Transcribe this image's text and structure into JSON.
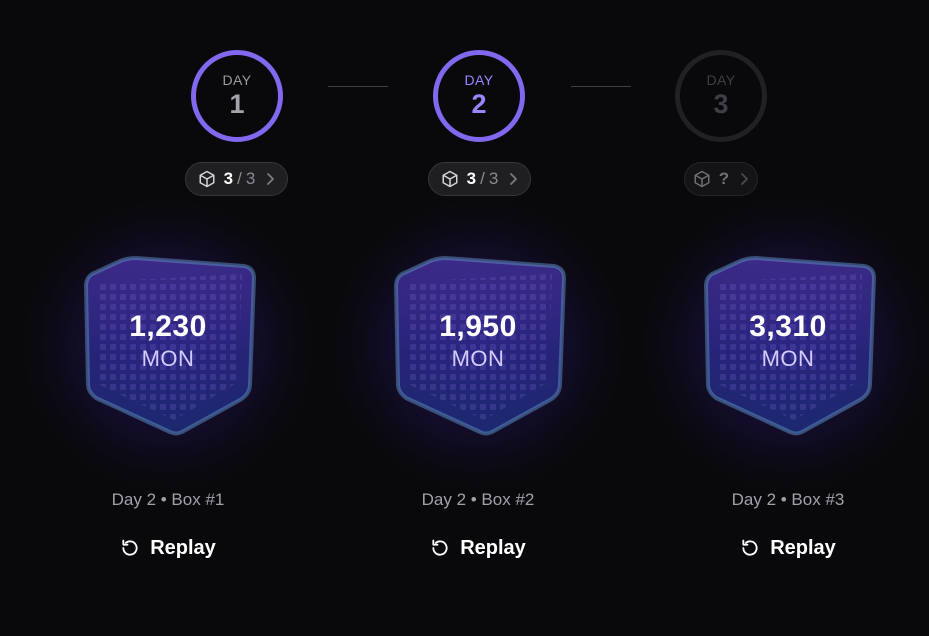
{
  "days": [
    {
      "label": "DAY",
      "number": "1",
      "state": "completed"
    },
    {
      "label": "DAY",
      "number": "2",
      "state": "current"
    },
    {
      "label": "DAY",
      "number": "3",
      "state": "locked"
    }
  ],
  "day_boxes": [
    {
      "opened": "3",
      "separator": "/",
      "total": "3",
      "icon": "cube-icon"
    },
    {
      "opened": "3",
      "separator": "/",
      "total": "3",
      "icon": "cube-icon"
    },
    {
      "unknown": "?",
      "icon": "cube-icon"
    }
  ],
  "rewards": [
    {
      "amount": "1,230",
      "currency": "MON",
      "caption": "Day 2 • Box #1",
      "action": "Replay"
    },
    {
      "amount": "1,950",
      "currency": "MON",
      "caption": "Day 2 • Box #2",
      "action": "Replay"
    },
    {
      "amount": "3,310",
      "currency": "MON",
      "caption": "Day 2 • Box #3",
      "action": "Replay"
    }
  ],
  "colors": {
    "background": "#09090b",
    "accent": "#8268ee",
    "accent_text": "#9a85ff",
    "locked": "#212124",
    "caption": "#a1a1aa"
  }
}
